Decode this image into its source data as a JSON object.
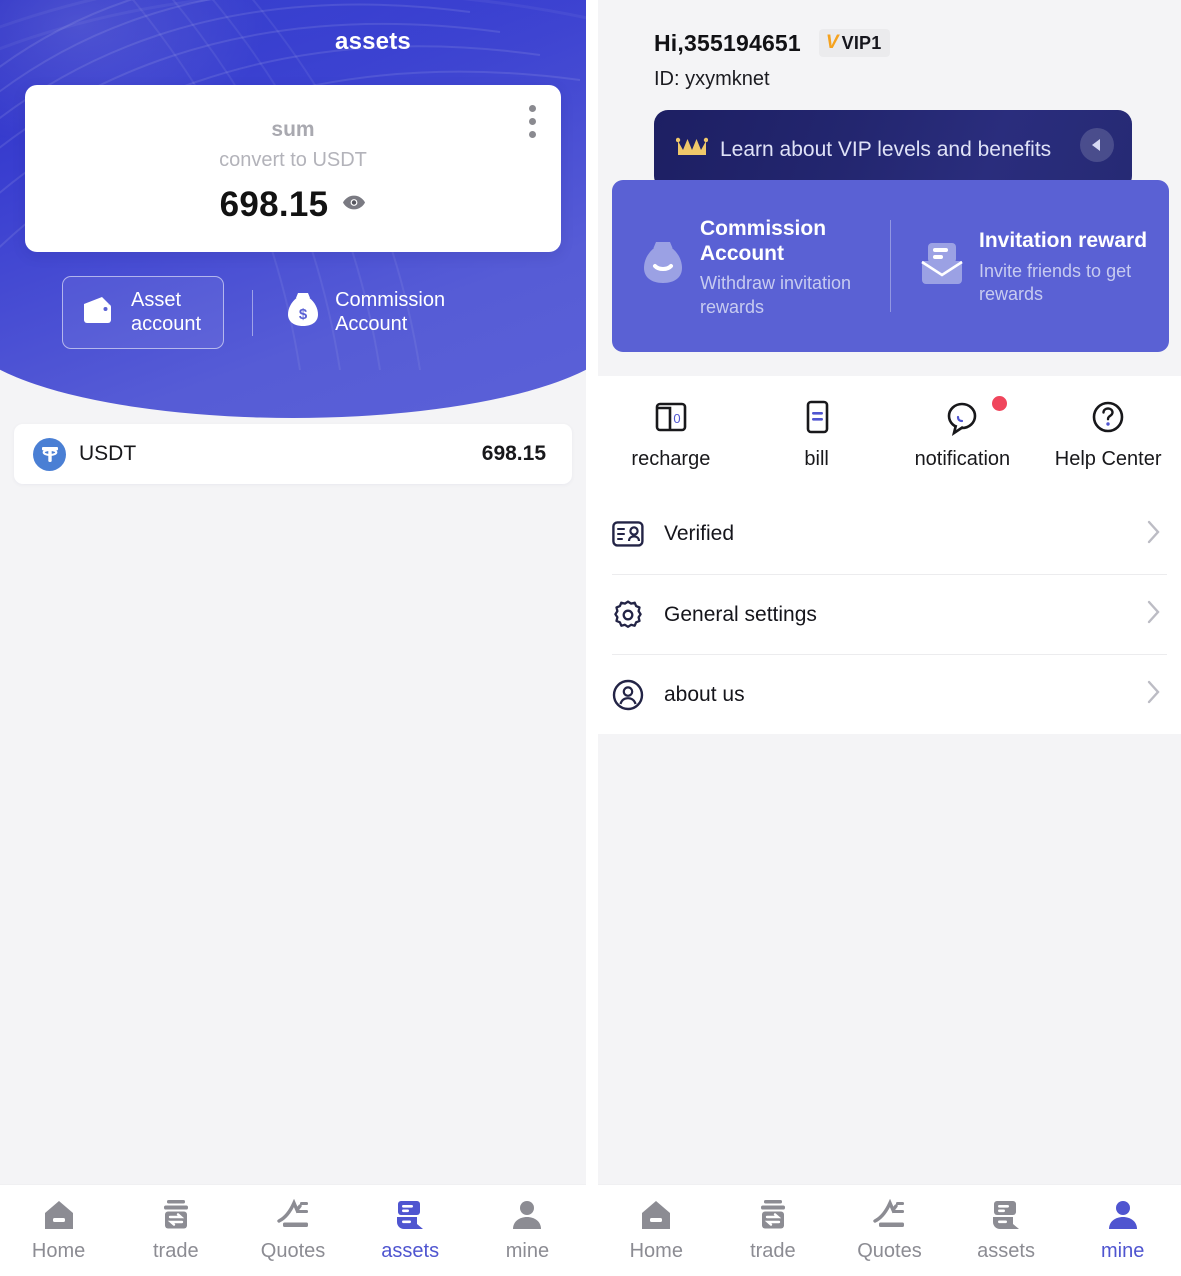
{
  "theme": {
    "accent": "#4f55d0",
    "hero_blue_dark": "#2b2fc4",
    "hero_blue_light": "#5b61d8",
    "promo_purple": "#5a61d4",
    "vip_navy": "#23266f",
    "badge_orange": "#f5a21e",
    "notify_red": "#f0455c",
    "page_bg": "#f4f4f6",
    "card_bg": "#ffffff",
    "text_dark": "#18181b",
    "text_muted": "#8c8c93",
    "usdt_blue": "#4a7fd4"
  },
  "assets_panel": {
    "header_title": "assets",
    "kebab_icon": "more-vertical-icon",
    "balance_card": {
      "label": "sum",
      "subtitle": "convert to USDT",
      "amount": "698.15",
      "eye_icon": "eye-icon"
    },
    "account_tabs": [
      {
        "label_line1": "Asset",
        "label_line2": "account",
        "icon": "wallet-icon",
        "active": true
      },
      {
        "label_line1": "Commission",
        "label_line2": "Account",
        "icon": "money-bag-icon",
        "active": false
      }
    ],
    "coins": [
      {
        "icon": "usdt-icon",
        "name": "USDT",
        "amount": "698.15"
      }
    ]
  },
  "mine_panel": {
    "greeting": "Hi,355194651",
    "vip_badge": {
      "glyph": "V",
      "label": "VIP1"
    },
    "user_id": "ID: yxymknet",
    "vip_banner": {
      "crown_icon": "crown-icon",
      "text": "Learn about VIP levels and benefits",
      "arrow_icon": "chevron-left-icon"
    },
    "promo_cards": [
      {
        "icon": "money-bag-icon",
        "title": "Commission Account",
        "subtitle": "Withdraw invitation rewards"
      },
      {
        "icon": "envelope-document-icon",
        "title": "Invitation reward",
        "subtitle": "Invite friends to get rewards"
      }
    ],
    "quick_actions": [
      {
        "icon": "recharge-wallet-icon",
        "label": "recharge",
        "badge": false
      },
      {
        "icon": "bill-document-icon",
        "label": "bill",
        "badge": false
      },
      {
        "icon": "chat-bubble-icon",
        "label": "notification",
        "badge": true
      },
      {
        "icon": "question-circle-icon",
        "label": "Help Center",
        "badge": false
      }
    ],
    "menu_items": [
      {
        "icon": "id-card-icon",
        "label": "Verified",
        "chevron": "chevron-right-icon"
      },
      {
        "icon": "gear-icon",
        "label": "General settings",
        "chevron": "chevron-right-icon"
      },
      {
        "icon": "user-circle-icon",
        "label": "about us",
        "chevron": "chevron-right-icon"
      }
    ]
  },
  "tabbar_left": {
    "items": [
      {
        "label": "Home",
        "icon": "home-icon",
        "active": false
      },
      {
        "label": "trade",
        "icon": "trade-icon",
        "active": false
      },
      {
        "label": "Quotes",
        "icon": "quotes-icon",
        "active": false
      },
      {
        "label": "assets",
        "icon": "assets-icon",
        "active": true
      },
      {
        "label": "mine",
        "icon": "person-icon",
        "active": false
      }
    ]
  },
  "tabbar_right": {
    "items": [
      {
        "label": "Home",
        "icon": "home-icon",
        "active": false
      },
      {
        "label": "trade",
        "icon": "trade-icon",
        "active": false
      },
      {
        "label": "Quotes",
        "icon": "quotes-icon",
        "active": false
      },
      {
        "label": "assets",
        "icon": "assets-icon",
        "active": false
      },
      {
        "label": "mine",
        "icon": "person-icon",
        "active": true
      }
    ]
  }
}
